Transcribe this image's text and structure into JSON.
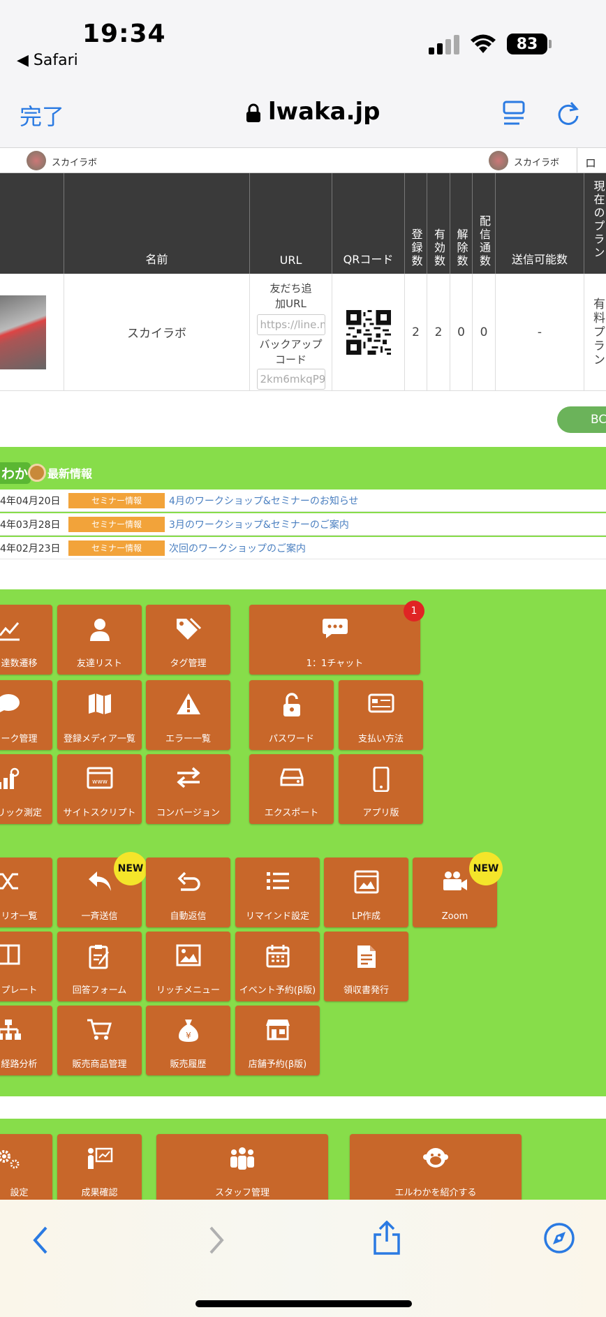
{
  "status": {
    "time": "19:34",
    "back_app": "◀ Safari",
    "battery": "83"
  },
  "browser": {
    "done": "完了",
    "domain": "lwaka.jp"
  },
  "account_bar": {
    "left_name": "スカイラボ",
    "right_name": "スカイラボ",
    "login": "ログ"
  },
  "table": {
    "headers": {
      "name": "名前",
      "url": "URL",
      "qr": "QRコード",
      "reg": "登録数",
      "valid": "有効数",
      "cancel": "解除数",
      "sent": "配信通数",
      "sendable": "送信可能数",
      "plan": "現在のプラン"
    },
    "row": {
      "name": "スカイラボ",
      "friend_label": "友だち追加URL",
      "friend_value": "https://line.me",
      "backup_label": "バックアップコード",
      "backup_value": "2km6mkqP9",
      "reg": "2",
      "valid": "2",
      "cancel": "0",
      "sent": "0",
      "sendable": "-",
      "plan": "有料プラン"
    }
  },
  "bc_button": "BC",
  "news": {
    "title": "最新情報",
    "logo_text": "わか",
    "items": [
      {
        "date": "4年04月20日",
        "tag": "セミナー情報",
        "text": "4月のワークショップ&セミナーのお知らせ"
      },
      {
        "date": "4年03月28日",
        "tag": "セミナー情報",
        "text": "3月のワークショップ&セミナーのご案内"
      },
      {
        "date": "4年02月23日",
        "tag": "セミナー情報",
        "text": "次回のワークショップのご案内"
      }
    ]
  },
  "menu1": {
    "chart": "達数遷移",
    "friends": "友達リスト",
    "tags": "タグ管理",
    "chat": "1：1チャット",
    "chat_badge": "1",
    "talk": "ーク管理",
    "media": "登録メディア一覧",
    "errors": "エラー一覧",
    "password": "パスワード",
    "payment": "支払い方法",
    "click": "リック測定",
    "site": "サイトスクリプト",
    "conversion": "コンバージョン",
    "export": "エクスポート",
    "app": "アプリ版"
  },
  "menu2": {
    "scenario": "リオ一覧",
    "broadcast": "一斉送信",
    "autoreply": "自動返信",
    "remind": "リマインド設定",
    "lp": "LP作成",
    "zoom": "Zoom",
    "template": "プレート",
    "form": "回答フォーム",
    "rich": "リッチメニュー",
    "event": "イベント予約(β版)",
    "receipt": "領収書発行",
    "route": "経路分析",
    "products": "販売商品管理",
    "sales": "販売履歴",
    "store": "店舗予約(β版)",
    "new": "NEW"
  },
  "menu3": {
    "settings": "設定",
    "results": "成果確認",
    "staff": "スタッフ管理",
    "introduce": "エルわかを紹介する"
  },
  "colors": {
    "accent": "#2a7ae2",
    "green": "#87dd4a",
    "tile": "#c8672a",
    "news_tag": "#f2a33a",
    "new_badge": "#f4e52a",
    "chat_badge": "#e02424"
  }
}
